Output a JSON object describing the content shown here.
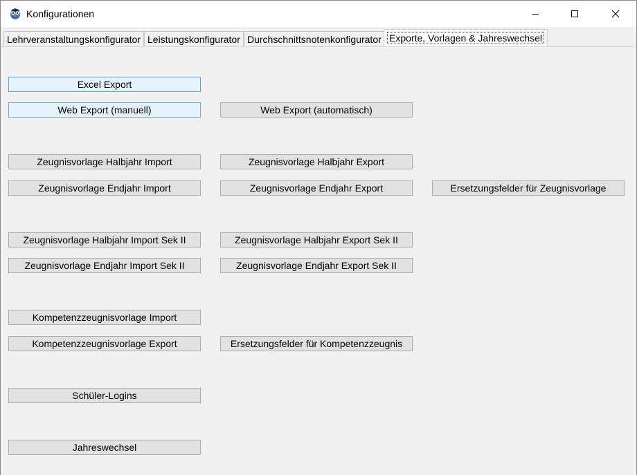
{
  "window": {
    "title": "Konfigurationen",
    "icon": "owl-app-icon",
    "controls": [
      "minimize-icon",
      "maximize-icon",
      "close-icon"
    ]
  },
  "tabs": [
    {
      "label": "Lehrveranstaltungskonfigurator",
      "active": false
    },
    {
      "label": "Leistungskonfigurator",
      "active": false
    },
    {
      "label": "Durchschnittsnotenkonfigurator",
      "active": false
    },
    {
      "label": "Exporte, Vorlagen & Jahreswechsel",
      "active": true
    }
  ],
  "buttons": {
    "excel_export": "Excel Export",
    "web_export_manual": "Web Export (manuell)",
    "web_export_auto": "Web Export (automatisch)",
    "zv_halbjahr_import": "Zeugnisvorlage Halbjahr Import",
    "zv_halbjahr_export": "Zeugnisvorlage Halbjahr Export",
    "zv_endjahr_import": "Zeugnisvorlage Endjahr Import",
    "zv_endjahr_export": "Zeugnisvorlage Endjahr Export",
    "ersetzungsfelder_zeugnisvorlage": "Ersetzungsfelder für Zeugnisvorlage",
    "zv_halbjahr_import_sek2": "Zeugnisvorlage Halbjahr Import Sek II",
    "zv_halbjahr_export_sek2": "Zeugnisvorlage Halbjahr Export Sek II",
    "zv_endjahr_import_sek2": "Zeugnisvorlage Endjahr Import Sek II",
    "zv_endjahr_export_sek2": "Zeugnisvorlage Endjahr Export Sek II",
    "kompetenz_import": "Kompetenzzeugnisvorlage Import",
    "kompetenz_export": "Kompetenzzeugnisvorlage Export",
    "ersetzungsfelder_kompetenz": "Ersetzungsfelder für Kompetenzzeugnis",
    "schueler_logins": "Schüler-Logins",
    "jahreswechsel": "Jahreswechsel"
  },
  "colors": {
    "button_face": "#e1e1e1",
    "button_border": "#adadad",
    "focus_face": "#e5f1fb",
    "focus_border": "#6d9fd4",
    "panel": "#f0f0f0"
  }
}
